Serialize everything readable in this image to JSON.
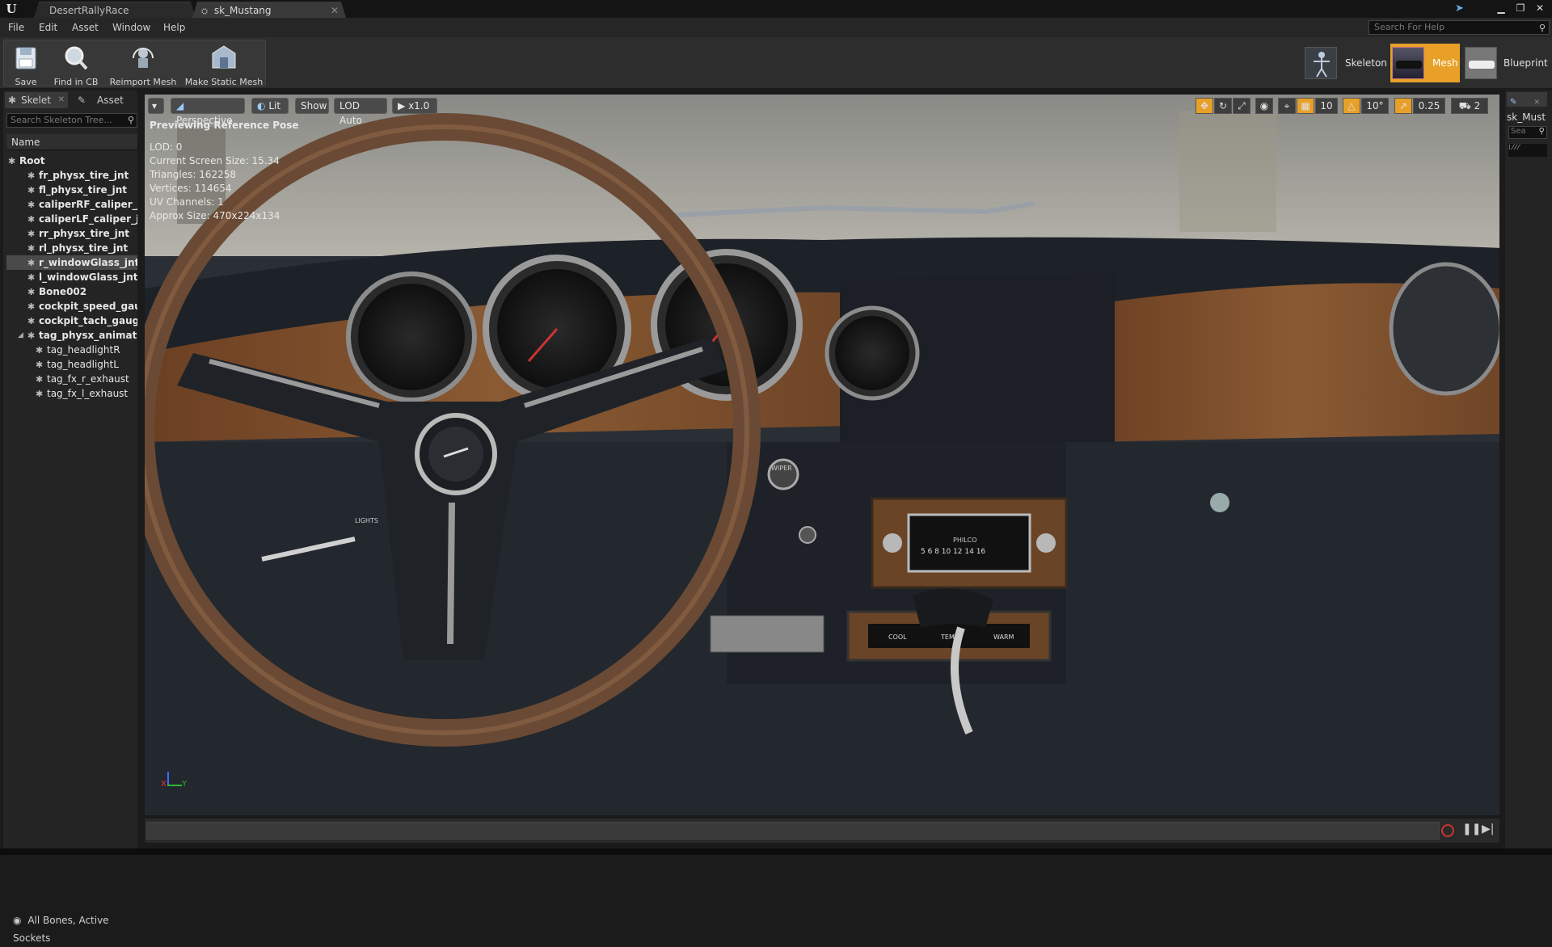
{
  "window": {
    "tabs": [
      {
        "label": "DesertRallyRace"
      },
      {
        "label": "sk_Mustang"
      }
    ]
  },
  "menu": [
    "File",
    "Edit",
    "Asset",
    "Window",
    "Help"
  ],
  "help_search": {
    "placeholder": "Search For Help"
  },
  "toolbar": {
    "buttons": [
      {
        "label": "Save",
        "icon": "save-icon"
      },
      {
        "label": "Find in CB",
        "icon": "magnifier-icon"
      },
      {
        "label": "Reimport Mesh",
        "icon": "reimport-icon"
      },
      {
        "label": "Make Static Mesh",
        "icon": "static-mesh-icon"
      }
    ]
  },
  "modes": [
    {
      "label": "Skeleton",
      "active": false
    },
    {
      "label": "Mesh",
      "active": true
    },
    {
      "label": "Blueprint",
      "active": false
    }
  ],
  "left_panel": {
    "tabs": [
      {
        "label": "Skelet"
      },
      {
        "label": "Asset"
      }
    ],
    "search_placeholder": "Search Skeleton Tree...",
    "column_header": "Name",
    "bones": [
      {
        "label": "Root",
        "level": 0,
        "selected": false
      },
      {
        "label": "fr_physx_tire_jnt",
        "level": 1,
        "selected": false
      },
      {
        "label": "fl_physx_tire_jnt",
        "level": 1,
        "selected": false
      },
      {
        "label": "caliperRF_caliper_jnt",
        "level": 1,
        "selected": false
      },
      {
        "label": "caliperLF_caliper_jnt",
        "level": 1,
        "selected": false
      },
      {
        "label": "rr_physx_tire_jnt",
        "level": 1,
        "selected": false
      },
      {
        "label": "rl_physx_tire_jnt",
        "level": 1,
        "selected": false
      },
      {
        "label": "r_windowGlass_jnt",
        "level": 1,
        "selected": true
      },
      {
        "label": "l_windowGlass_jnt",
        "level": 1,
        "selected": false
      },
      {
        "label": "Bone002",
        "level": 1,
        "selected": false
      },
      {
        "label": "cockpit_speed_gauge",
        "level": 1,
        "selected": false
      },
      {
        "label": "cockpit_tach_gauge_",
        "level": 1,
        "selected": false
      },
      {
        "label": "tag_physx_animate",
        "level": 1,
        "selected": false
      },
      {
        "label": "tag_headlightR",
        "level": 2,
        "selected": false
      },
      {
        "label": "tag_headlightL",
        "level": 2,
        "selected": false
      },
      {
        "label": "tag_fx_r_exhaust",
        "level": 2,
        "selected": false
      },
      {
        "label": "tag_fx_l_exhaust",
        "level": 2,
        "selected": false
      }
    ],
    "footer": "All Bones, Active Sockets"
  },
  "viewport": {
    "toolbar": {
      "perspective": "Perspective",
      "lit": "Lit",
      "show": "Show",
      "lod": "LOD Auto",
      "speed": "x1.0",
      "grid_snap": "10",
      "rot_snap": "10°",
      "scale_snap": "0.25",
      "cam_speed": "2"
    },
    "info": {
      "mode": "Previewing Reference Pose",
      "lod": "LOD: 0",
      "screen_size": "Current Screen Size: 15.34",
      "triangles": "Triangles: 162258",
      "vertices": "Vertices: 114654",
      "uv_channels": "UV Channels: 1",
      "approx_size": "Approx Size: 470x224x134"
    },
    "radio_label": "PHILCO",
    "radio_numbers": "5 6 8 10 12 14 16",
    "climate_labels": [
      "COOL",
      "TEMP",
      "WARM"
    ],
    "lights_label": "LIGHTS",
    "wiper_label": "WIPER",
    "axis": {
      "x": "X",
      "y": "Y"
    }
  },
  "right_panel": {
    "title": "sk_Must",
    "search_placeholder": "Sea"
  },
  "colors": {
    "accent_orange": "#e8a028",
    "wood": "#7a4a26",
    "dash_dark": "#1c2026",
    "selected_bone": "#4a4a4a"
  }
}
